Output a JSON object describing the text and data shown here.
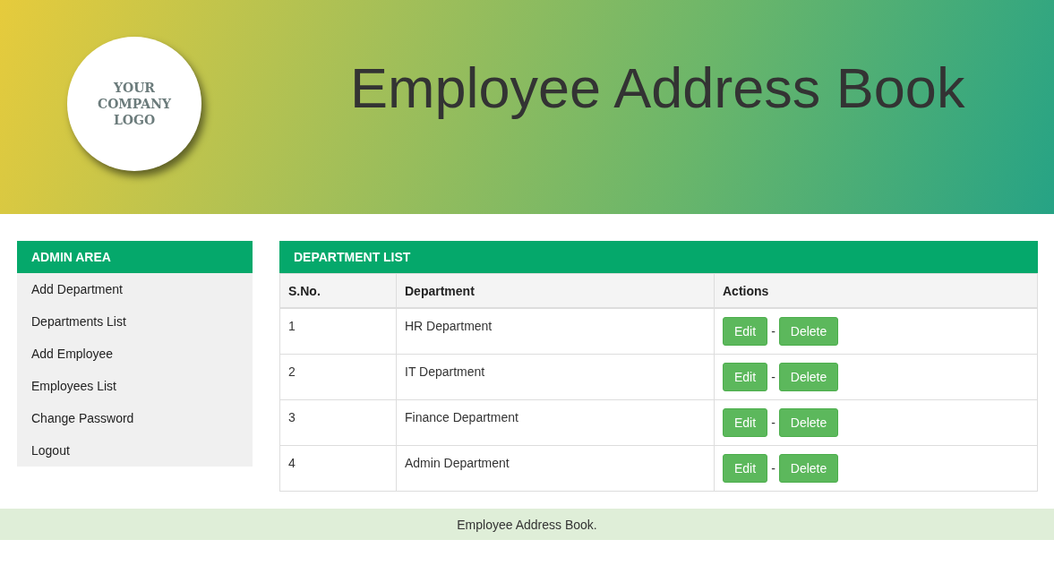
{
  "header": {
    "logo_lines": [
      "YOUR",
      "COMPANY",
      "LOGO"
    ],
    "title": "Employee Address Book"
  },
  "sidebar": {
    "title": "ADMIN AREA",
    "items": [
      "Add Department",
      "Departments List",
      "Add Employee",
      "Employees List",
      "Change Password",
      "Logout"
    ]
  },
  "panel": {
    "title": "DEPARTMENT LIST",
    "columns": [
      "S.No.",
      "Department",
      "Actions"
    ],
    "rows": [
      {
        "sno": "1",
        "department": "HR Department",
        "edit": "Edit",
        "separator": "-",
        "delete": "Delete"
      },
      {
        "sno": "2",
        "department": "IT Department",
        "edit": "Edit",
        "separator": "-",
        "delete": "Delete"
      },
      {
        "sno": "3",
        "department": "Finance Department",
        "edit": "Edit",
        "separator": "-",
        "delete": "Delete"
      },
      {
        "sno": "4",
        "department": "Admin Department",
        "edit": "Edit",
        "separator": "-",
        "delete": "Delete"
      }
    ]
  },
  "footer": "Employee Address Book."
}
